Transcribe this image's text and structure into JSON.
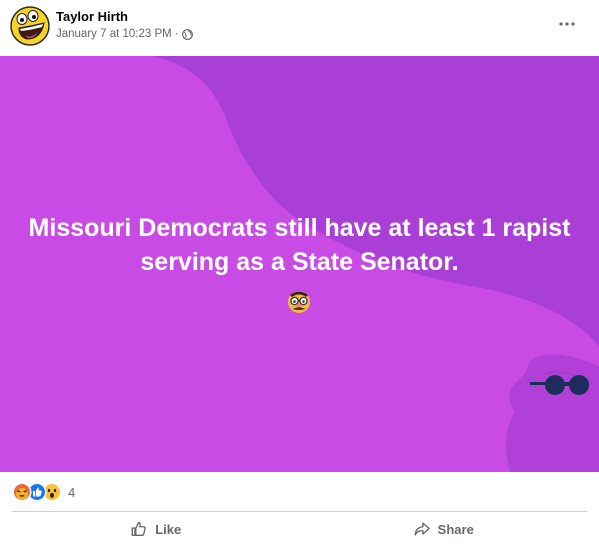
{
  "post": {
    "author": "Taylor Hirth",
    "date": "January 7 at 10:23 PM",
    "separator": "·",
    "audience_icon": "globe-icon",
    "more_icon": "more-options-icon",
    "avatar_icon": "awesome-face-icon",
    "body_lines": [
      "Missouri Democrats still have at least 1 rapist",
      "serving as a State Senator."
    ],
    "body_emoji_icon": "disguised-face-icon",
    "background_colors": {
      "base": "#c94be6",
      "wave": "#a93fd6",
      "figure": "#b040d8",
      "glasses": "#1c2d5c"
    }
  },
  "reactions": {
    "icons": [
      "angry-icon",
      "like-icon",
      "wow-icon"
    ],
    "count": "4"
  },
  "actions": {
    "like_label": "Like",
    "share_label": "Share"
  }
}
